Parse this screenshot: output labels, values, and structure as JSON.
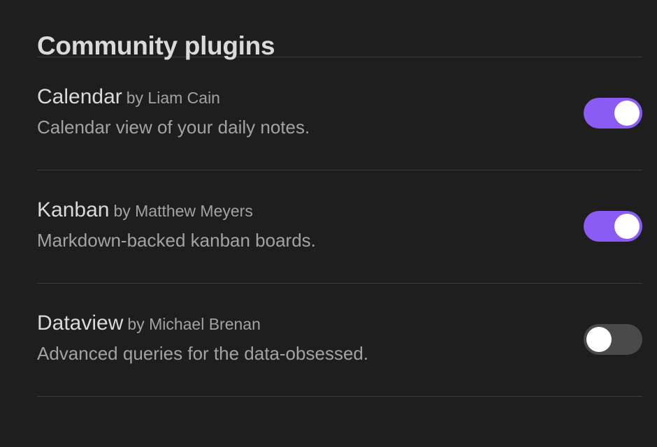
{
  "page": {
    "title": "Community plugins"
  },
  "plugins": [
    {
      "name": "Calendar",
      "author": "by Liam Cain",
      "description": "Calendar view of your daily notes.",
      "enabled": true
    },
    {
      "name": "Kanban",
      "author": "by Matthew Meyers",
      "description": "Markdown-backed kanban boards.",
      "enabled": true
    },
    {
      "name": "Dataview",
      "author": "by Michael Brenan",
      "description": "Advanced queries for the data-obsessed.",
      "enabled": false
    }
  ],
  "colors": {
    "background": "#1e1e1e",
    "accent": "#8a5cf5",
    "toggle_off": "#4a4a4a",
    "divider": "#3d3d3d",
    "text_primary": "#dadada",
    "text_muted": "#a3a3a3"
  }
}
